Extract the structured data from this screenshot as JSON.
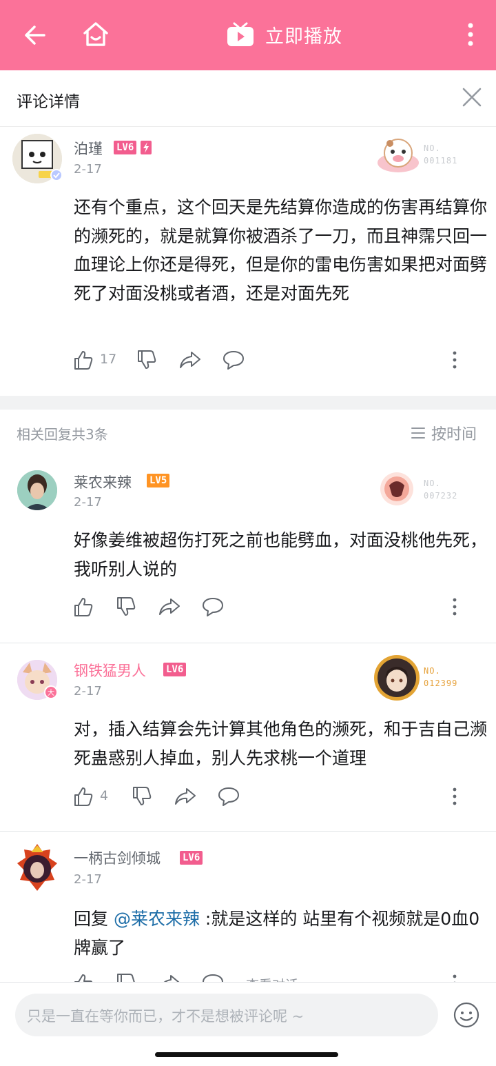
{
  "topbar": {
    "play_label": "立即播放",
    "icons": [
      "back-arrow-icon",
      "home-icon",
      "tv-play-icon",
      "more-vertical-icon"
    ]
  },
  "header": {
    "title": "评论详情"
  },
  "main_comment": {
    "username": "泊瑾",
    "level": "LV6",
    "date": "2-17",
    "text": "还有个重点，这个回天是先结算你造成的伤害再结算你的濒死的，就是就算你被酒杀了一刀，而且神霈只回一血理论上你还是得死，但是你的雷电伤害如果把对面劈死了对面没桃或者酒，还是对面先死",
    "badge_no_label": "NO.",
    "badge_no": "001181",
    "likes": "17"
  },
  "replies_header": {
    "count_label": "相关回复共3条",
    "sort_label": "按时间"
  },
  "replies": [
    {
      "username": "莱农来辣",
      "level": "LV5",
      "date": "2-17",
      "text": "好像姜维被超伤打死之前也能劈血，对面没桃他先死，我听别人说的",
      "badge_no_label": "NO.",
      "badge_no": "007232",
      "likes": ""
    },
    {
      "username": "钢铁猛男人",
      "level": "LV6",
      "date": "2-17",
      "text": "对，插入结算会先计算其他角色的濒死，和于吉自己濒死蛊惑别人掉血，别人先求桃一个道理",
      "badge_no_label": "NO.",
      "badge_no": "012399",
      "likes": "4"
    },
    {
      "username": "一柄古剑倾城",
      "level": "LV6",
      "date": "2-17",
      "reply_prefix": "回复 ",
      "mention": "@莱农来辣",
      "text": " :就是这样的 站里有个视频就是0血0牌赢了",
      "partial_action": "查看对话"
    }
  ],
  "input": {
    "placeholder": "只是一直在等你而已，才不是想被评论呢 ~"
  },
  "colors": {
    "brand_pink": "#fb7299",
    "text_gray": "#9499a0",
    "mention_blue": "#1e6ea8"
  }
}
